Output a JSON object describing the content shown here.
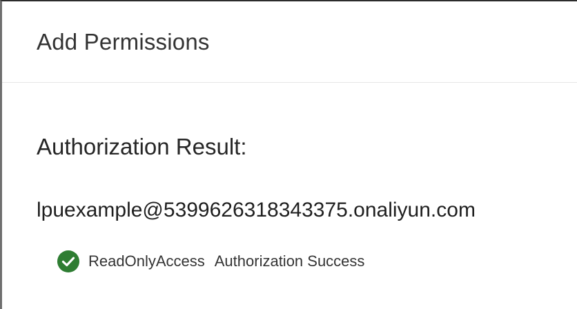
{
  "dialog": {
    "title": "Add Permissions"
  },
  "result": {
    "heading": "Authorization Result:",
    "account": "lpuexample@5399626318343375.onaliyun.com",
    "entries": [
      {
        "policy": "ReadOnlyAccess",
        "status": "Authorization Success",
        "icon": "check-circle-icon",
        "icon_color": "#2e7d32"
      }
    ]
  }
}
